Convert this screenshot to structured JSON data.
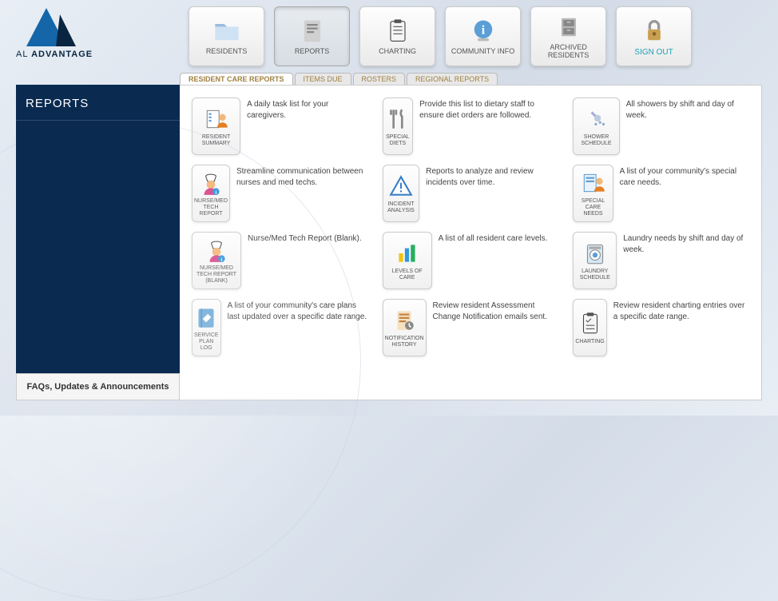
{
  "brand": {
    "name_light": "AL",
    "name_bold": "ADVANTAGE"
  },
  "nav": [
    {
      "id": "residents",
      "label": "RESIDENTS"
    },
    {
      "id": "reports",
      "label": "REPORTS",
      "active": true
    },
    {
      "id": "charting",
      "label": "CHARTING"
    },
    {
      "id": "community",
      "label": "COMMUNITY INFO"
    },
    {
      "id": "archived",
      "label": "ARCHIVED RESIDENTS"
    },
    {
      "id": "signout",
      "label": "SIGN OUT"
    }
  ],
  "tabs": [
    {
      "id": "care_reports",
      "label": "RESIDENT CARE REPORTS",
      "active": true
    },
    {
      "id": "items_due",
      "label": "ITEMS DUE"
    },
    {
      "id": "rosters",
      "label": "ROSTERS"
    },
    {
      "id": "regional",
      "label": "REGIONAL REPORTS"
    }
  ],
  "sidebar": {
    "title": "REPORTS",
    "footer": "FAQs, Updates & Announcements"
  },
  "reports": [
    {
      "label": "RESIDENT SUMMARY",
      "desc": "A daily task list for your caregivers."
    },
    {
      "label": "SPECIAL DIETS",
      "desc": "Provide this list to dietary staff to ensure diet orders are followed."
    },
    {
      "label": "SHOWER SCHEDULE",
      "desc": "All showers by shift and day of week."
    },
    {
      "label": "NURSE/MED TECH REPORT",
      "desc": "Streamline communication between nurses and med techs."
    },
    {
      "label": "INCIDENT ANALYSIS",
      "desc": "Reports to analyze and review incidents over time."
    },
    {
      "label": "SPECIAL CARE NEEDS",
      "desc": "A list of your community's special care needs."
    },
    {
      "label": "NURSE/MED TECH REPORT (BLANK)",
      "desc": "Nurse/Med Tech Report (Blank)."
    },
    {
      "label": "LEVELS OF CARE",
      "desc": "A list of all resident care levels."
    },
    {
      "label": "LAUNDRY SCHEDULE",
      "desc": "Laundry needs by shift and day of week."
    },
    {
      "label": "SERVICE PLAN LOG",
      "desc": "A list of your community's care plans last updated over a specific date range."
    },
    {
      "label": "NOTIFICATION HISTORY",
      "desc": "Review resident Assessment Change Notification emails sent."
    },
    {
      "label": "CHARTING",
      "desc": "Review resident charting entries over a specific date range."
    }
  ]
}
